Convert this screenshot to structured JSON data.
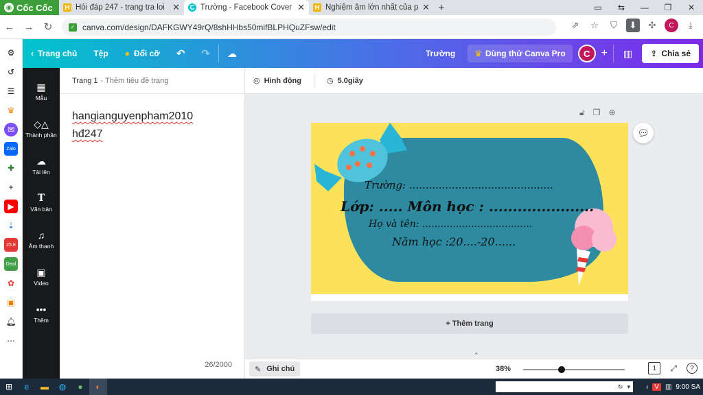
{
  "browser": {
    "brand": "Cốc Cốc",
    "tabs": [
      {
        "title": "Hỏi đáp 247 - trang tra loi",
        "icon": "h-icon",
        "active": false
      },
      {
        "title": "Trường - Facebook Cover",
        "icon": "canva-icon",
        "active": true
      },
      {
        "title": "Nghiệm âm lớn nhất của pt tr",
        "icon": "h-icon",
        "active": false
      }
    ],
    "url": "canva.com/design/DAFKGWY49rQ/8shHHbs50mifBLPHQuZFsw/edit",
    "profile_initial": "C"
  },
  "topbar": {
    "home": "Trang chủ",
    "file": "Tệp",
    "resize": "Đổi cỡ",
    "doc_title": "Trường",
    "try_pro": "Dùng thử Canva Pro",
    "avatar": "C",
    "share": "Chia sẻ"
  },
  "rail": [
    {
      "label": "Mẫu",
      "icon": "template-icon"
    },
    {
      "label": "Thành phần",
      "icon": "elements-icon"
    },
    {
      "label": "Tải lên",
      "icon": "upload-icon"
    },
    {
      "label": "Văn bản",
      "icon": "text-icon"
    },
    {
      "label": "Âm thanh",
      "icon": "audio-icon"
    },
    {
      "label": "Video",
      "icon": "video-icon"
    },
    {
      "label": "Thêm",
      "icon": "more-icon"
    }
  ],
  "notes": {
    "page_label": "Trang 1",
    "page_sub": "- Thêm tiêu đề trang",
    "lines": [
      "hangianguyenpham2010",
      "hđ247"
    ],
    "counter": "26/2000"
  },
  "canvas_toolbar": {
    "animate": "Hình động",
    "duration": "5.0giây"
  },
  "design": {
    "line1": "Trường: ............................................",
    "line2": "Lớp: .....  Môn học : ......................",
    "line3": "Họ và tên: ....................................",
    "line4": "Năm học :20....-20......",
    "bg_color": "#fce25a",
    "blob_color": "#2d8aa0"
  },
  "add_page": "+ Thêm trang",
  "statusbar": {
    "notes_btn": "Ghi chú",
    "zoom": "38%",
    "zoom_value": 0.38,
    "page_num": "1"
  },
  "taskbar": {
    "time": "9:00 SA"
  },
  "colors": {
    "accent_start": "#00c4cc",
    "accent_end": "#7d2ae8",
    "brand_green": "#3c9f3a"
  }
}
